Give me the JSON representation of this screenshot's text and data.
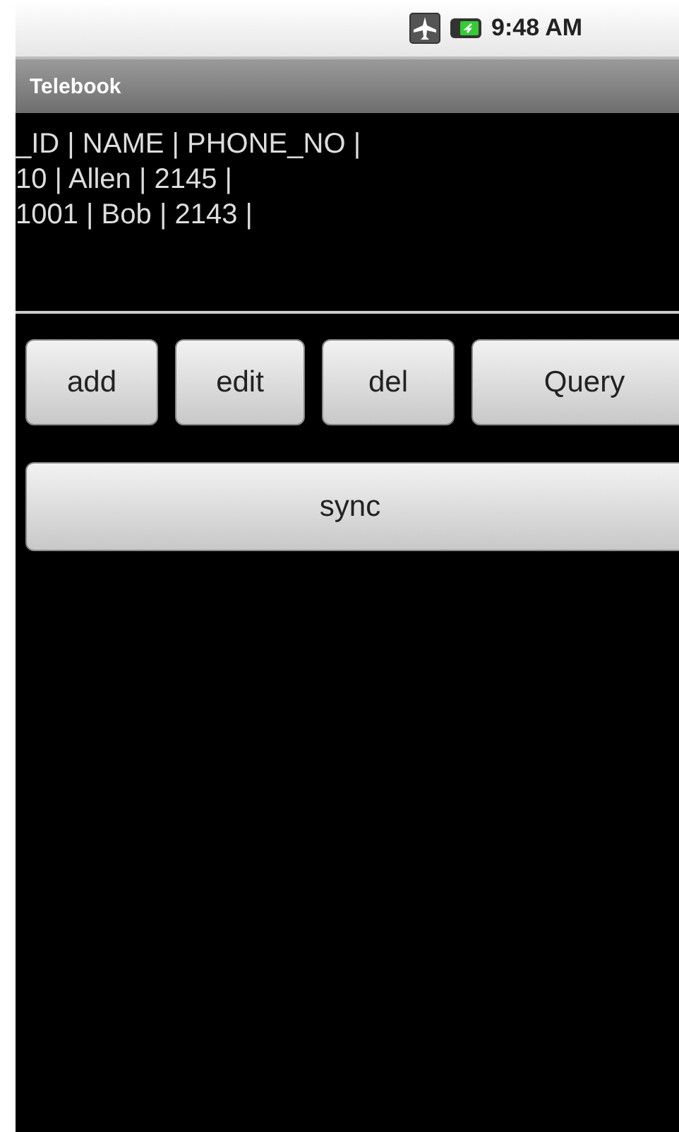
{
  "status_bar": {
    "time": "9:48 AM"
  },
  "window": {
    "title": "Telebook"
  },
  "records": [
    "_ID | NAME | PHONE_NO |",
    "10 | Allen | 2145 |",
    "1001 | Bob | 2143 |"
  ],
  "buttons": [
    "add",
    "edit",
    "del",
    "Query"
  ],
  "sync_button": "sync"
}
